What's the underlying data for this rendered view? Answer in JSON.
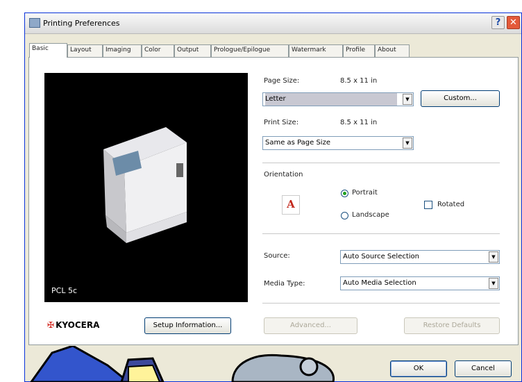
{
  "window": {
    "title": "Printing Preferences",
    "help_glyph": "?",
    "close_glyph": "✕"
  },
  "tabs": [
    "Basic",
    "Layout",
    "Imaging",
    "Color",
    "Output",
    "Prologue/Epilogue",
    "Watermark",
    "Profile",
    "About"
  ],
  "preview": {
    "label": "PCL 5c"
  },
  "page_size": {
    "label": "Page Size:",
    "dims": "8.5 x 11 in",
    "value": "Letter",
    "custom_button": "Custom..."
  },
  "print_size": {
    "label": "Print Size:",
    "dims": "8.5 x 11 in",
    "value": "Same as Page Size"
  },
  "orientation": {
    "label": "Orientation",
    "icon_glyph": "A",
    "portrait": "Portrait",
    "landscape": "Landscape",
    "rotated": "Rotated",
    "selected": "portrait"
  },
  "source": {
    "label": "Source:",
    "value": "Auto Source Selection"
  },
  "media_type": {
    "label": "Media Type:",
    "value": "Auto Media Selection"
  },
  "buttons": {
    "setup_information": "Setup Information...",
    "advanced": "Advanced...",
    "restore_defaults": "Restore Defaults",
    "ok": "OK",
    "cancel": "Cancel"
  },
  "brand": {
    "logo_text": "KYOCERA"
  },
  "colors": {
    "accent": "#0831d9",
    "brand_red": "#d2231b",
    "panel_bg": "#ece9d8"
  }
}
